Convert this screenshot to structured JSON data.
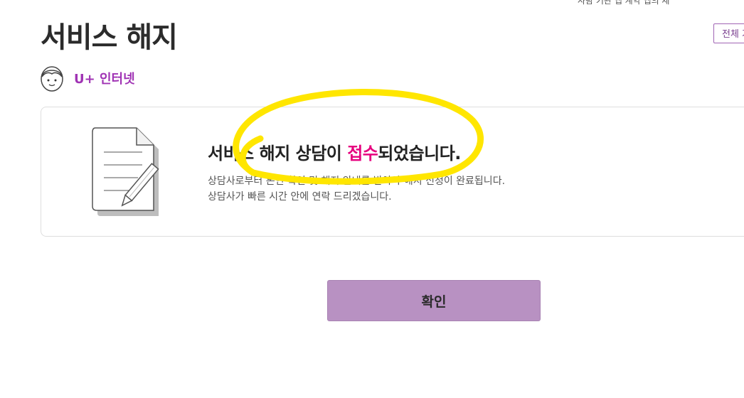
{
  "header": {
    "title": "서비스 해지",
    "top_right_button": "전체 가",
    "top_cut_text": "사람 기관 앱 계약 앱의 세"
  },
  "service": {
    "avatar_icon": "face-avatar-icon",
    "name": "U+ 인터넷",
    "name_color": "#a033b4"
  },
  "result": {
    "illustration_icon": "document-pencil-icon",
    "headline_before": "서비스 해지 상담이 ",
    "headline_highlight": "접수",
    "headline_after": "되었습니다.",
    "highlight_color": "#e6007e",
    "desc_line1": "상담사로부터 본인 확인 및 해지 안내를 받아야 해지 신청이 완료됩니다.",
    "desc_line2": "상담사가 빠른 시간 안에 연락 드리겠습니다."
  },
  "actions": {
    "confirm_label": "확인",
    "confirm_color": "#b891c2"
  },
  "annotation": {
    "scribble_color": "#ffe600"
  }
}
